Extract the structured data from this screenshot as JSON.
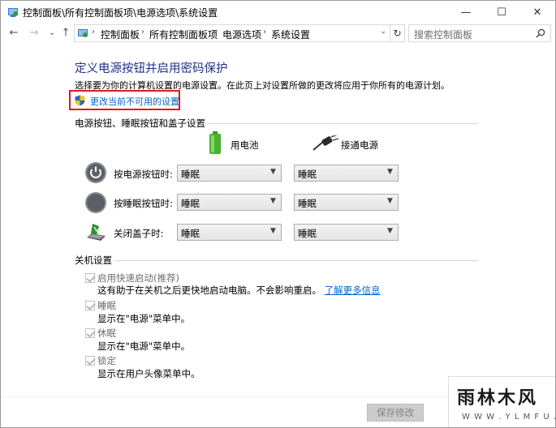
{
  "window": {
    "title": "控制面板\\所有控制面板项\\电源选项\\系统设置",
    "min_glyph": "—",
    "max_glyph": "☐",
    "close_glyph": "✕"
  },
  "nav": {
    "back_glyph": "←",
    "forward_glyph": "→",
    "recent_glyph": "⌄",
    "up_glyph": "↑",
    "breadcrumbs": [
      "控制面板",
      "所有控制面板项",
      "电源选项",
      "系统设置"
    ],
    "sep_glyph": "›",
    "dropdown_glyph": "⌄",
    "refresh_glyph": "↻",
    "search_placeholder": "搜索控制面板"
  },
  "page": {
    "heading": "定义电源按钮并启用密码保护",
    "description": "选择要为你的计算机设置的电源设置。在此页上对设置所做的更改将应用于你所有的电源计划。",
    "change_link": "更改当前不可用的设置"
  },
  "power_section": {
    "title": "电源按钮、睡眠按钮和盖子设置",
    "col_battery": "用电池",
    "col_plugged": "接通电源",
    "rows": [
      {
        "label": "按电源按钮时:",
        "battery": "睡眠",
        "plugged": "睡眠"
      },
      {
        "label": "按睡眠按钮时:",
        "battery": "睡眠",
        "plugged": "睡眠"
      },
      {
        "label": "关闭盖子时:",
        "battery": "睡眠",
        "plugged": "睡眠"
      }
    ]
  },
  "shutdown_section": {
    "title": "关机设置",
    "options": [
      {
        "label": "启用快速启动(推荐)",
        "desc": "这有助于在关机之后更快地启动电脑。不会影响重启。",
        "link": "了解更多信息",
        "checked": true
      },
      {
        "label": "睡眠",
        "desc": "显示在\"电源\"菜单中。",
        "checked": true
      },
      {
        "label": "休眠",
        "desc": "显示在\"电源\"菜单中。",
        "checked": true
      },
      {
        "label": "锁定",
        "desc": "显示在用户头像菜单中。",
        "checked": true
      }
    ]
  },
  "footer": {
    "save_label": "保存修改"
  },
  "watermark": {
    "line1": "雨林木风",
    "line2": "W W W . Y L M F U . C O M"
  },
  "colors": {
    "heading": "#1e3287",
    "link": "#0066cc",
    "highlight_box": "#e0181c"
  }
}
